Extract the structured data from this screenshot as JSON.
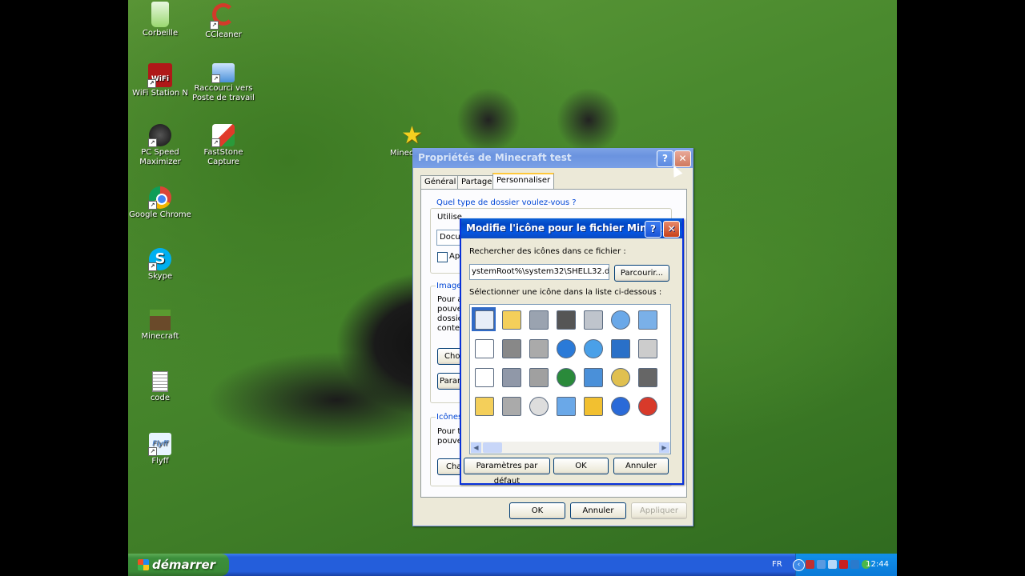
{
  "desktop_icons": [
    {
      "name": "recycle-bin-icon",
      "label": "Corbeille",
      "color": "#6fc23a"
    },
    {
      "name": "ccleaner-icon",
      "label": "CCleaner",
      "color": "#d23a2a"
    },
    {
      "name": "wifi-station-icon",
      "label": "WiFi Station N",
      "color": "#c82020"
    },
    {
      "name": "network-shortcut-icon",
      "label": "Raccourci vers Poste de travail",
      "color": "#4a90d9"
    },
    {
      "name": "pc-speed-icon",
      "label": "PC Speed Maximizer",
      "color": "#333333"
    },
    {
      "name": "faststone-icon",
      "label": "FastStone Capture",
      "color": "#e03a2a"
    },
    {
      "name": "chrome-icon",
      "label": "Google Chrome",
      "color": "#e8b020"
    },
    {
      "name": "skype-icon",
      "label": "Skype",
      "color": "#00aff0"
    },
    {
      "name": "minecraft-icon",
      "label": "Minecraft",
      "color": "#5a4a30"
    },
    {
      "name": "text-file-icon",
      "label": "code",
      "color": "#ffffff"
    },
    {
      "name": "flyff-icon",
      "label": "Flyff",
      "color": "#e8f4ff"
    }
  ],
  "star_icon_label": "Minec",
  "properties_dialog": {
    "title": "Propriétés de Minecraft test",
    "tabs": [
      "Général",
      "Partage",
      "Personnaliser"
    ],
    "group_folder_type": "Quel type de dossier voulez-vous ?",
    "use_label": "Utilise",
    "select_value": "Docu",
    "apply_checkbox": "Ap",
    "group_images": "Image",
    "images_text": [
      "Pour a",
      "pouve",
      "dossie",
      "conte"
    ],
    "choose_button": "Cho",
    "params_button": "Paran",
    "group_icons": "Icônes",
    "icons_text": [
      "Pour t",
      "pouve"
    ],
    "change_button": "Cha",
    "ok": "OK",
    "cancel": "Annuler",
    "apply": "Appliquer"
  },
  "icon_dialog": {
    "title": "Modifie l'icône pour le fichier Minec...",
    "search_label": "Rechercher des icônes dans ce fichier :",
    "file_path": "ystemRoot%\\system32\\SHELL32.dll",
    "browse": "Parcourir...",
    "select_label": "Sélectionner une icône dans la liste ci-dessous :",
    "defaults": "Paramètres par défaut",
    "ok": "OK",
    "cancel": "Annuler",
    "icons": [
      "blank-window-icon",
      "folder-open-icon",
      "drive-icon",
      "chip-icon",
      "printer-icon",
      "clock-icon",
      "window-icon",
      "document-icon",
      "network-drive-icon",
      "drive-stack-icon",
      "globe-icon",
      "monitor-globe-icon",
      "check-icon",
      "shortcut-icon",
      "window-blank-icon",
      "floppy-icon",
      "drive-x-icon",
      "mouse-globe-icon",
      "network-icon",
      "magnifier-icon",
      "terminal-icon",
      "folder-icon",
      "disk-icon",
      "cd-icon",
      "computers-icon",
      "calendar-icon",
      "help-icon",
      "power-icon"
    ]
  },
  "taskbar": {
    "start": "démarrer",
    "lang": "FR",
    "time": "12:44"
  }
}
